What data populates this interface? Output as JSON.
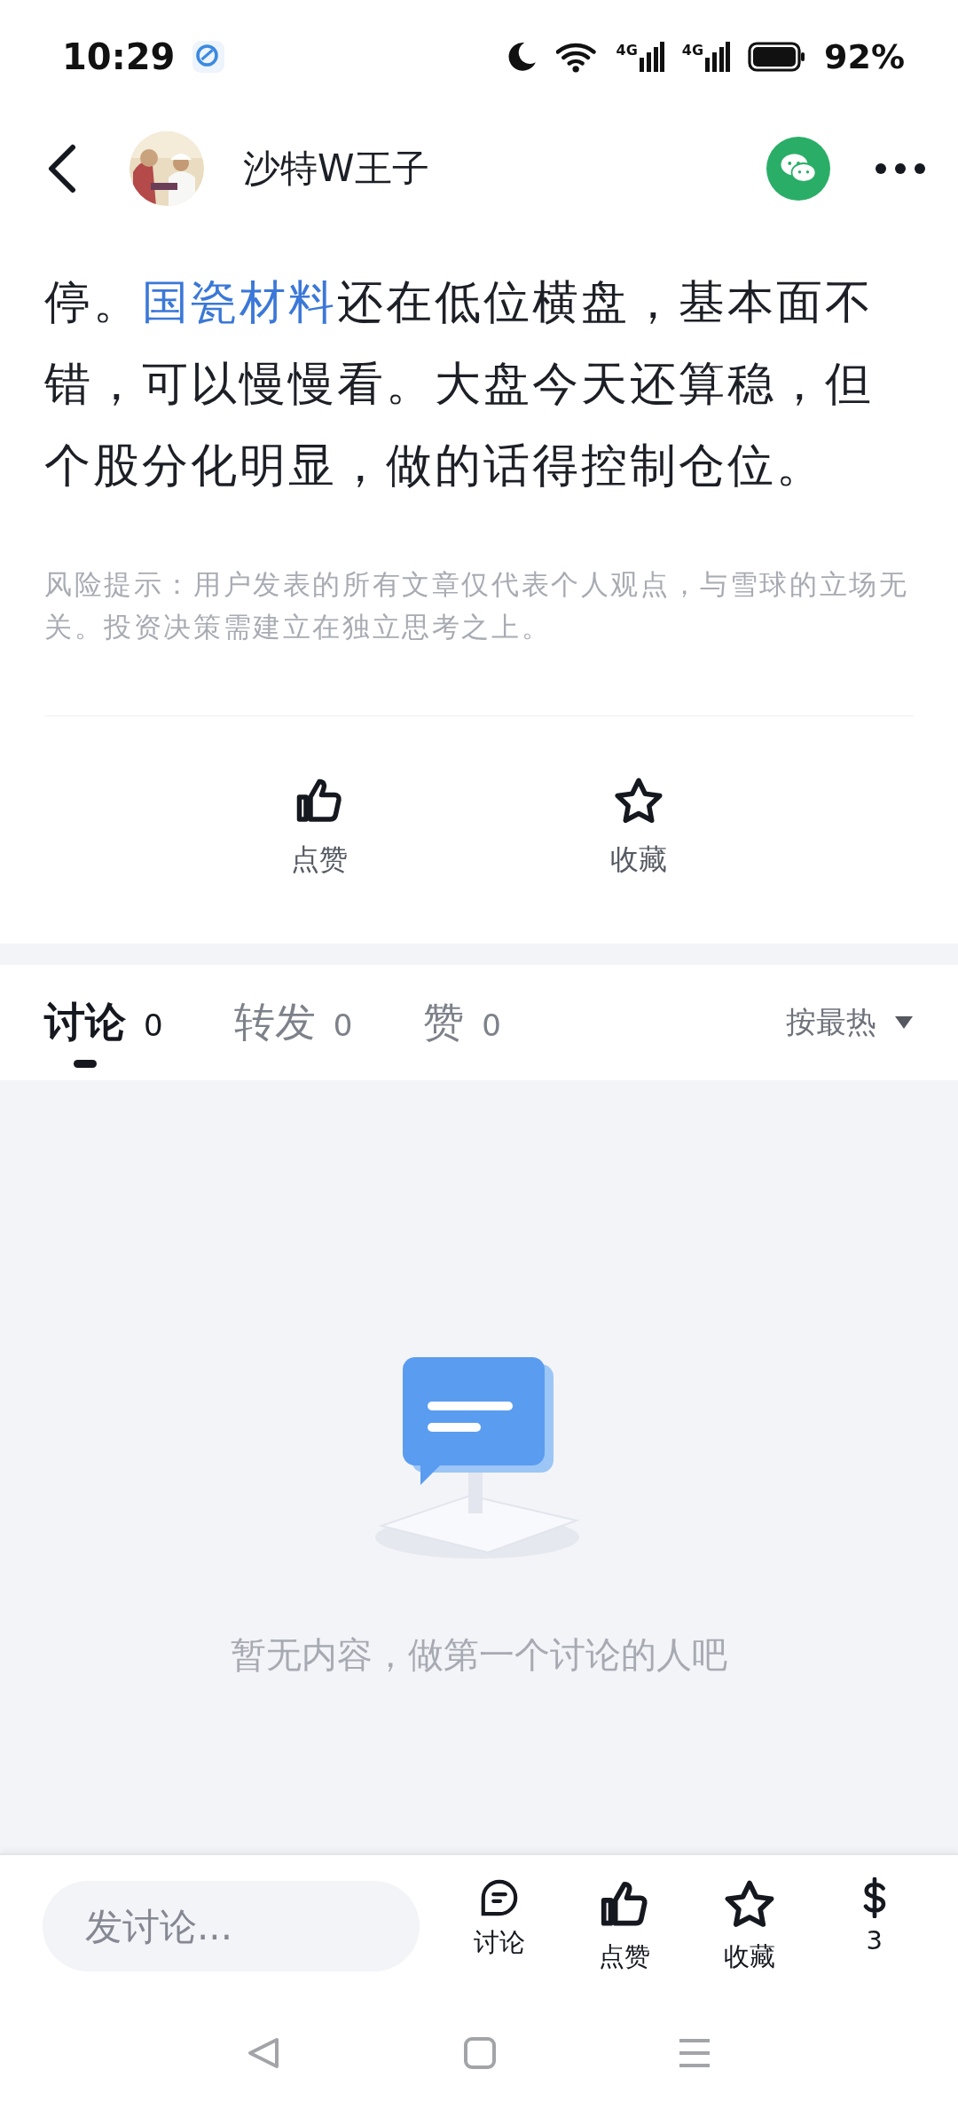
{
  "status_bar": {
    "time": "10:29",
    "signals": [
      "4G",
      "4G"
    ],
    "battery": "92%"
  },
  "header": {
    "author": "沙特W王子"
  },
  "article": {
    "segments": [
      {
        "text": "停。",
        "link": false
      },
      {
        "text": "国瓷材料",
        "link": true
      },
      {
        "text": "还在低位横盘，基本面不错，可以慢慢看。大盘今天还算稳，但个股分化明显，做的话得控制仓位。",
        "link": false
      }
    ],
    "disclaimer": "风险提示：用户发表的所有文章仅代表个人观点，与雪球的立场无关。投资决策需建立在独立思考之上。"
  },
  "actions": [
    {
      "kind": "like",
      "label": "点赞"
    },
    {
      "kind": "star",
      "label": "收藏"
    }
  ],
  "tabs": [
    {
      "label": "讨论",
      "count": "0",
      "selected": true
    },
    {
      "label": "转发",
      "count": "0",
      "selected": false
    },
    {
      "label": "赞",
      "count": "0",
      "selected": false
    }
  ],
  "sort": "按最热",
  "empty_text": "暂无内容，做第一个讨论的人吧",
  "bottom_bar": {
    "placeholder": "发讨论...",
    "buttons": [
      {
        "kind": "comment",
        "label": "讨论"
      },
      {
        "kind": "like",
        "label": "点赞"
      },
      {
        "kind": "star",
        "label": "收藏"
      },
      {
        "kind": "reward",
        "label": "3"
      }
    ]
  }
}
